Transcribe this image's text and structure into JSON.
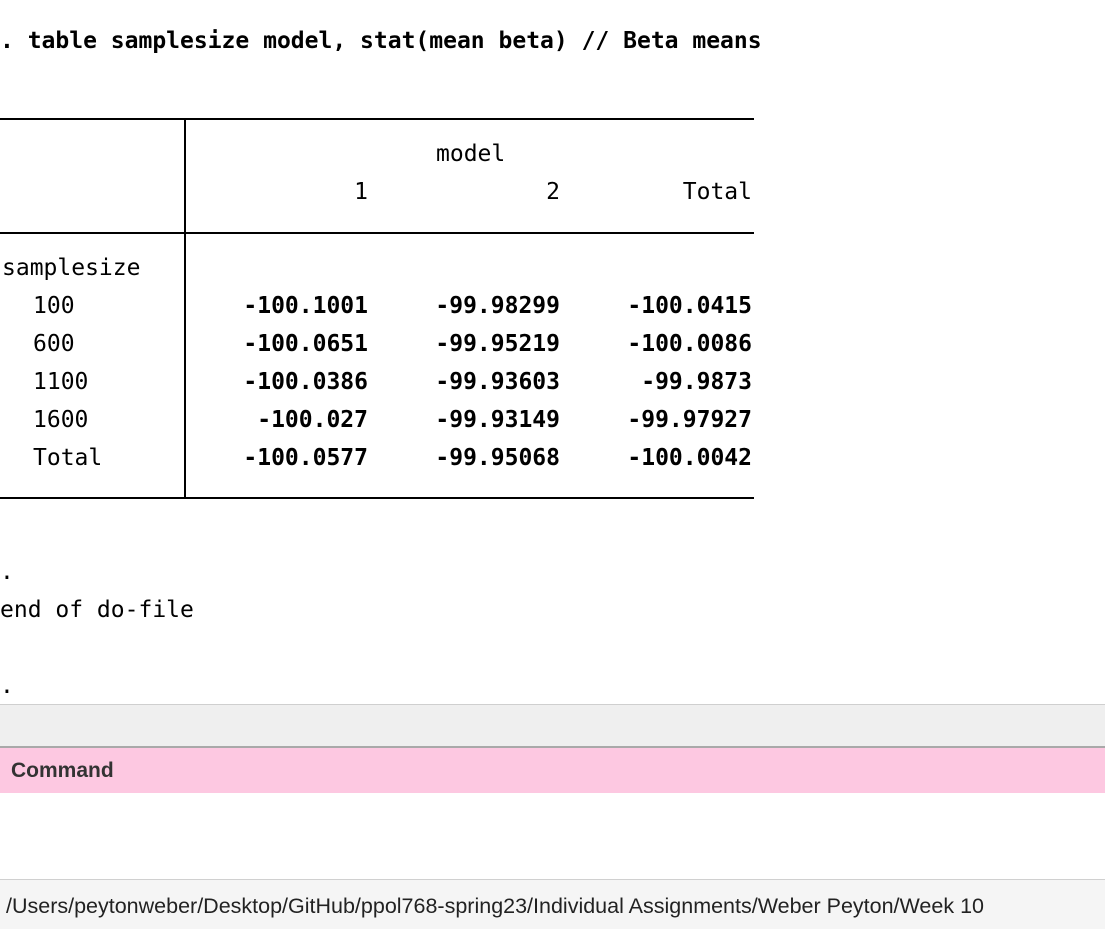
{
  "results": {
    "command_line": ". table samplesize model, stat(mean beta) // Beta means",
    "table": {
      "column_var": "model",
      "columns": [
        "1",
        "2",
        "Total"
      ],
      "row_var": "samplesize",
      "rows": [
        {
          "label": "100",
          "values": [
            "-100.1001",
            "-99.98299",
            "-100.0415"
          ]
        },
        {
          "label": "600",
          "values": [
            "-100.0651",
            "-99.95219",
            "-100.0086"
          ]
        },
        {
          "label": "1100",
          "values": [
            "-100.0386",
            "-99.93603",
            "-99.9873"
          ]
        },
        {
          "label": "1600",
          "values": [
            "-100.027",
            "-99.93149",
            "-99.97927"
          ]
        },
        {
          "label": "Total",
          "values": [
            "-100.0577",
            "-99.95068",
            "-100.0042"
          ]
        }
      ]
    },
    "trailing": [
      ".",
      "end of do-file",
      "."
    ]
  },
  "command": {
    "header": "Command",
    "value": ""
  },
  "status": {
    "path": "/Users/peytonweber/Desktop/GitHub/ppol768-spring23/Individual Assignments/Weber Peyton/Week 10"
  }
}
